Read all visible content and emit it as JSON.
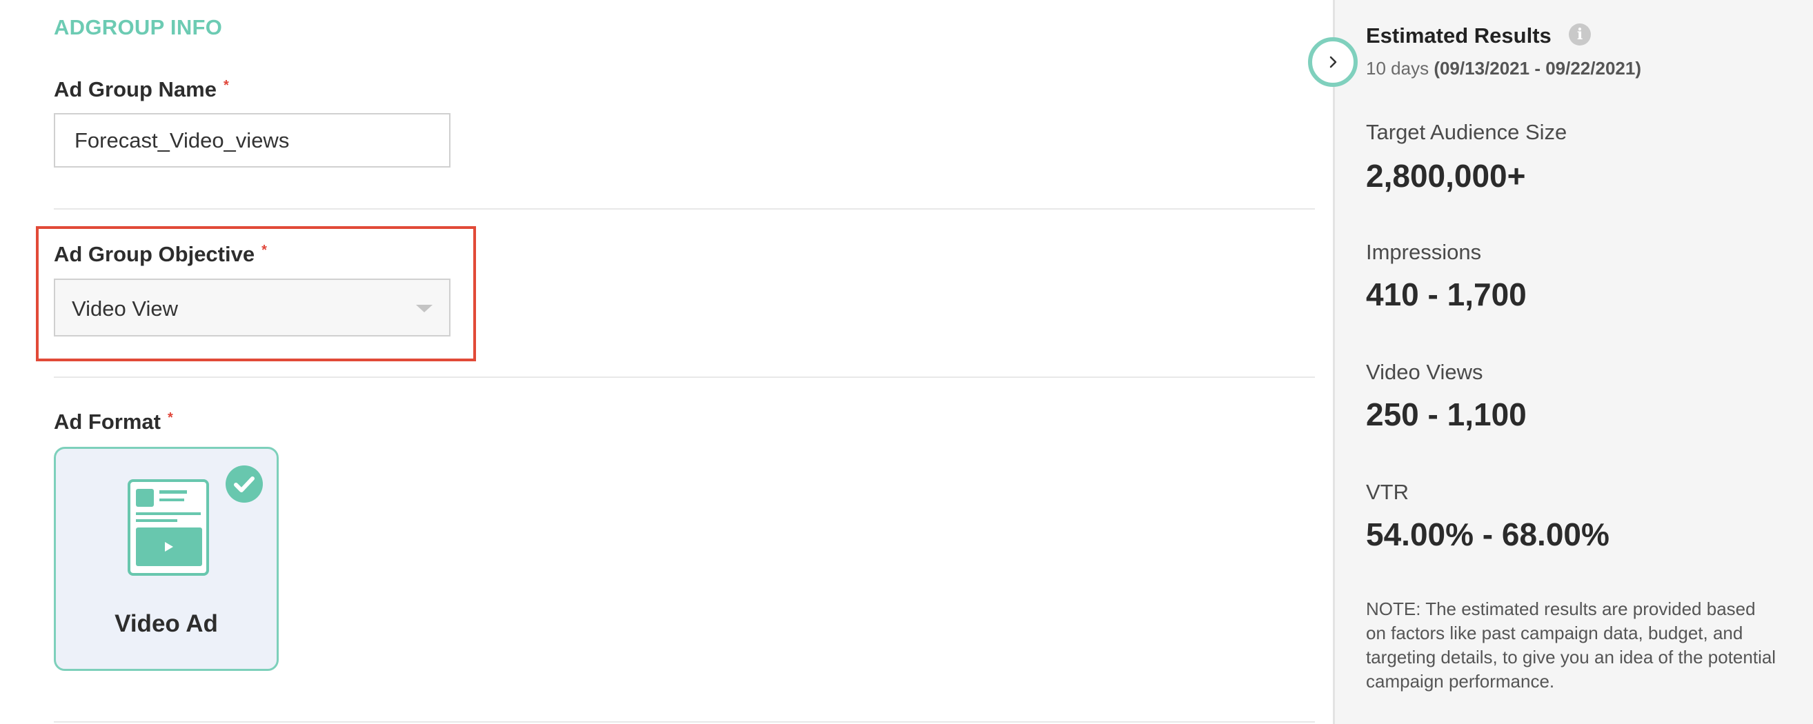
{
  "section": {
    "title": "ADGROUP INFO"
  },
  "ad_group_name": {
    "label": "Ad Group Name",
    "required_mark": "*",
    "value": "Forecast_Video_views"
  },
  "ad_group_objective": {
    "label": "Ad Group Objective",
    "required_mark": "*",
    "selected": "Video View"
  },
  "ad_format": {
    "label": "Ad Format",
    "required_mark": "*",
    "card_label": "Video Ad",
    "selected": true
  },
  "estimated_results": {
    "title": "Estimated Results",
    "info_icon": "i",
    "days": "10 days",
    "date_range": "(09/13/2021 - 09/22/2021)",
    "metrics": [
      {
        "label": "Target Audience Size",
        "value": "2,800,000+"
      },
      {
        "label": "Impressions",
        "value": "410 - 1,700"
      },
      {
        "label": "Video Views",
        "value": "250 - 1,100"
      },
      {
        "label": "VTR",
        "value": "54.00% - 68.00%"
      }
    ],
    "note": "NOTE: The estimated results are provided based on factors like past campaign data, budget, and targeting details, to give you an idea of the potential campaign performance."
  },
  "colors": {
    "accent": "#6ccbb3",
    "highlight_border": "#e14a38",
    "required": "#e0463a",
    "card_bg": "#edf1f9",
    "sidebar_bg": "#f5f5f5"
  },
  "icons": [
    "chevron-right-icon",
    "info-icon",
    "checkmark-icon",
    "video-ad-icon",
    "dropdown-caret-icon"
  ]
}
